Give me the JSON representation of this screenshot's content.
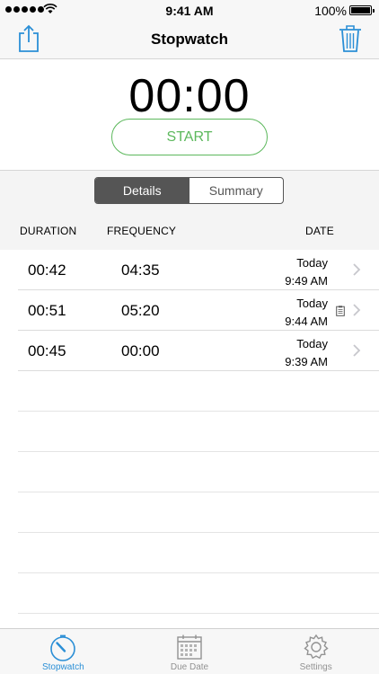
{
  "status_bar": {
    "time": "9:41 AM",
    "battery": "100%"
  },
  "nav": {
    "title": "Stopwatch",
    "left_icon": "share-icon",
    "right_icon": "trash-icon"
  },
  "timer": {
    "display": "00:00",
    "start_label": "START"
  },
  "segments": [
    {
      "label": "Details",
      "selected": true
    },
    {
      "label": "Summary",
      "selected": false
    }
  ],
  "columns": {
    "duration": "DURATION",
    "frequency": "FREQUENCY",
    "date": "DATE"
  },
  "rows": [
    {
      "duration": "00:42",
      "frequency": "04:35",
      "day": "Today",
      "time": "9:49 AM",
      "has_note": false
    },
    {
      "duration": "00:51",
      "frequency": "05:20",
      "day": "Today",
      "time": "9:44 AM",
      "has_note": true
    },
    {
      "duration": "00:45",
      "frequency": "00:00",
      "day": "Today",
      "time": "9:39 AM",
      "has_note": false
    }
  ],
  "tabs": [
    {
      "label": "Stopwatch",
      "icon": "stopwatch-icon",
      "active": true
    },
    {
      "label": "Due Date",
      "icon": "calendar-icon",
      "active": false
    },
    {
      "label": "Settings",
      "icon": "gear-icon",
      "active": false
    }
  ],
  "colors": {
    "accent": "#2b8fd6",
    "start_green": "#5cb85c"
  }
}
